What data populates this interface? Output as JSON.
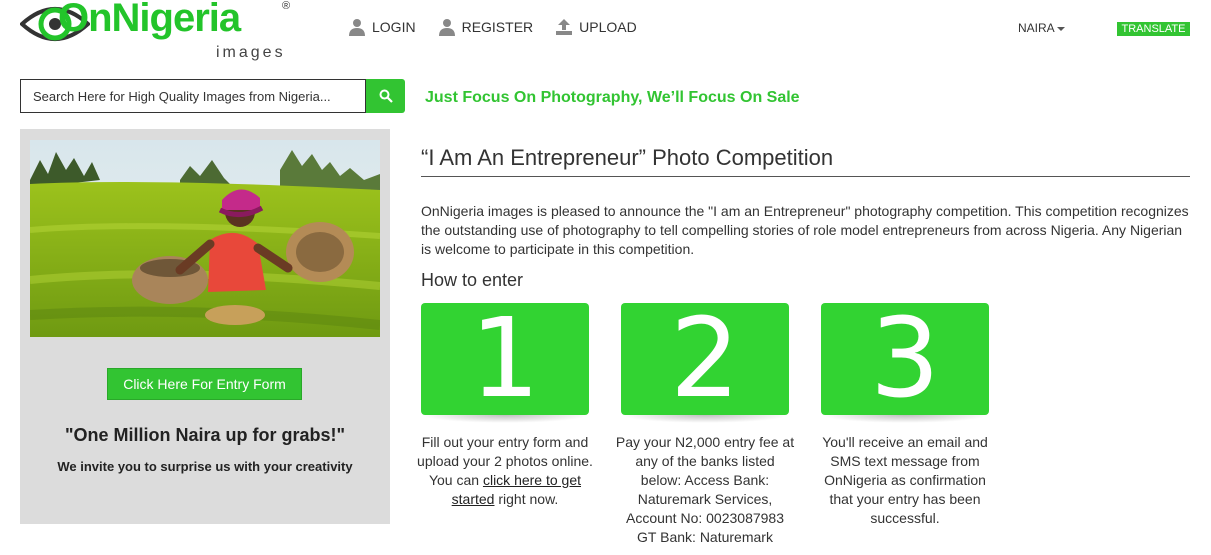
{
  "brand": {
    "name": "OnNigeria",
    "sub": "images",
    "reg": "®"
  },
  "nav": {
    "login": "LOGIN",
    "register": "REGISTER",
    "upload": "UPLOAD",
    "currency": "NAIRA",
    "translate": "TRANSLATE"
  },
  "search": {
    "placeholder": "Search Here for High Quality Images from Nigeria..."
  },
  "tagline": "Just Focus On Photography, We’ll Focus On Sale",
  "sidebar": {
    "entry_button": "Click Here For Entry Form",
    "prize": "\"One Million Naira up for grabs!\"",
    "invite": "We invite you to surprise us with your creativity"
  },
  "main": {
    "title": "“I Am An Entrepreneur” Photo Competition",
    "intro": "OnNigeria images is pleased to announce the \"I am an Entrepreneur\" photography competition. This competition recognizes the outstanding use of photography to tell compelling stories of role model entrepreneurs from across Nigeria. Any Nigerian is welcome to participate in this competition.",
    "how_to_enter": "How to enter",
    "steps": [
      {
        "number": "1",
        "text_before": "Fill out your entry form and upload your 2 photos online. You can",
        "link": "click here to get started",
        "text_after": "right now."
      },
      {
        "number": "2",
        "text": "Pay your N2,000 entry fee at any of the banks listed below: Access Bank: Naturemark Services, Account No: 0023087983 GT Bank: Naturemark"
      },
      {
        "number": "3",
        "text": "You'll receive an email and SMS text message from OnNigeria as confirmation that your entry has been successful."
      }
    ]
  },
  "colors": {
    "accent": "#32c432",
    "step_box": "#32d332",
    "panel_bg": "#dcdcdc"
  },
  "icons": {
    "login": "user-icon",
    "register": "user-icon",
    "upload": "upload-icon",
    "search": "search-icon"
  }
}
